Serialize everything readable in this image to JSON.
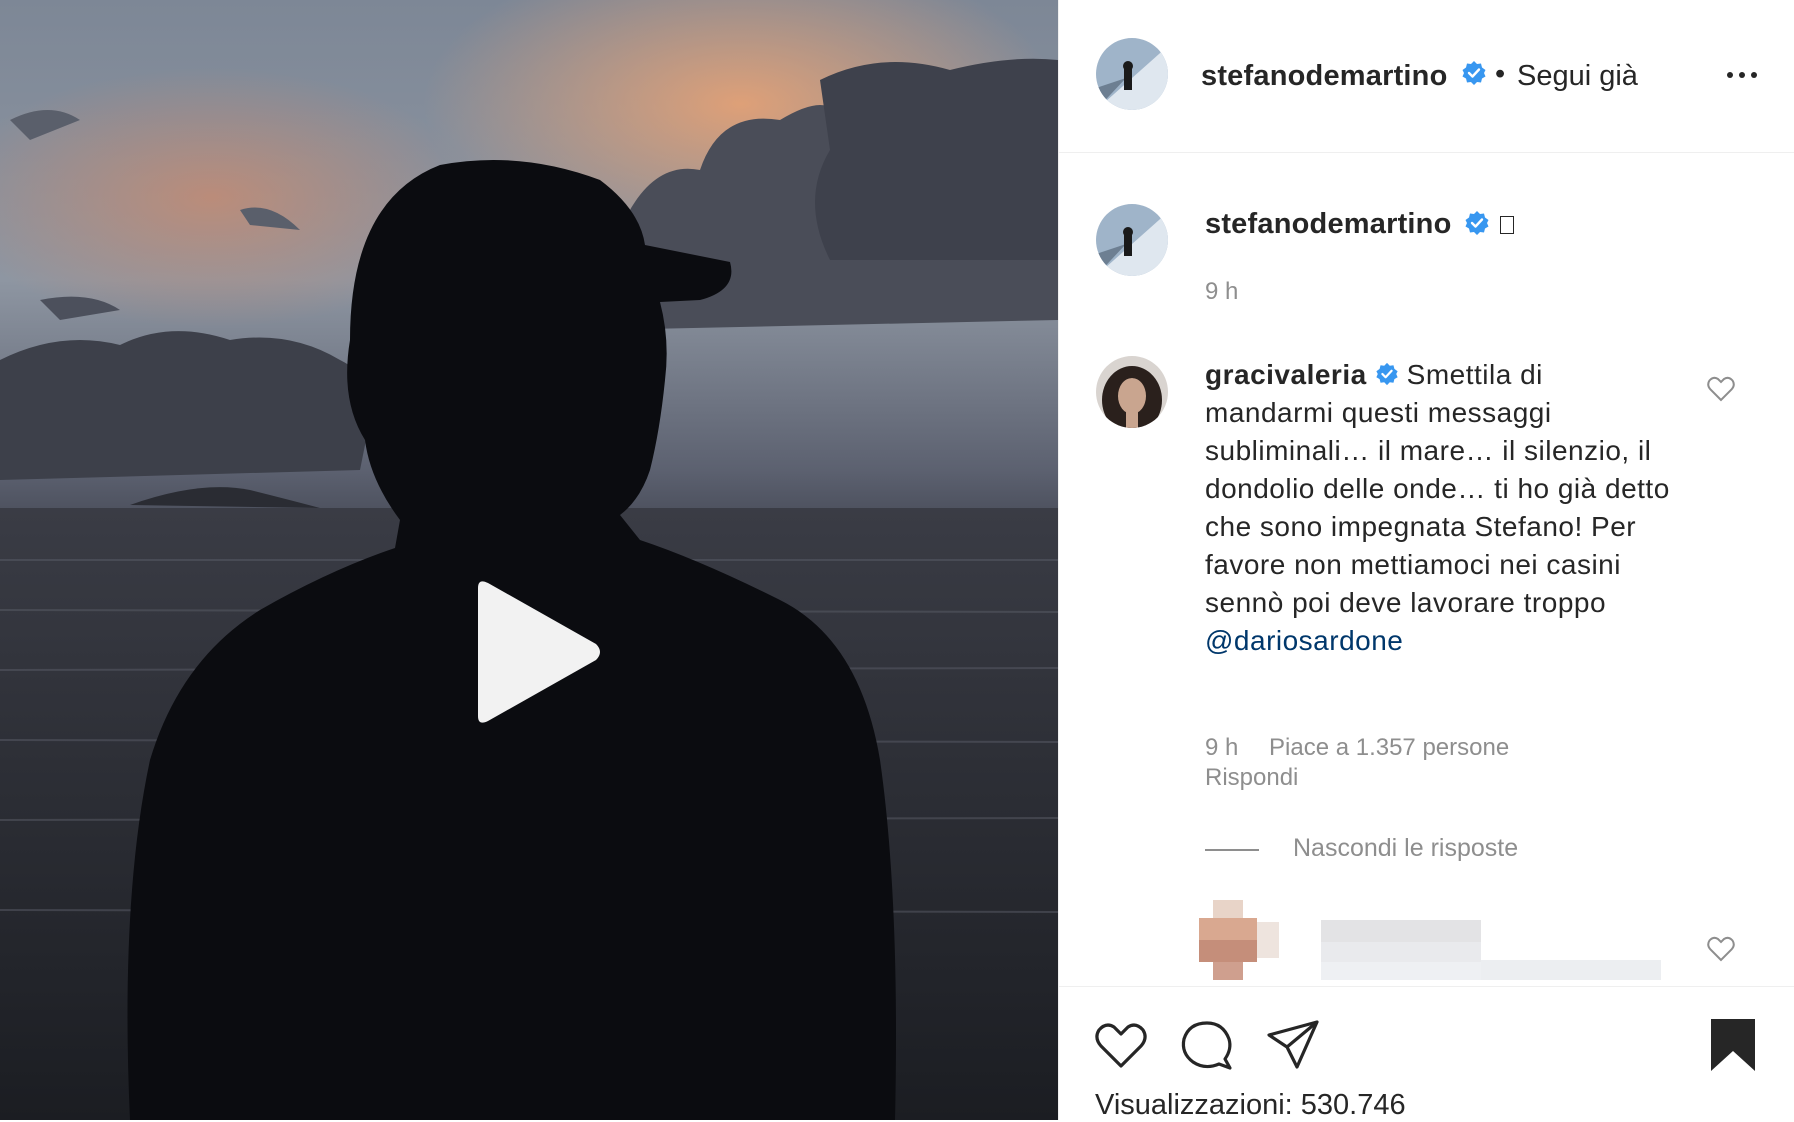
{
  "post": {
    "username": "stefanodemartino",
    "separator": "•",
    "follow_label": "Segui già"
  },
  "caption": {
    "username": "stefanodemartino",
    "time": "9 h"
  },
  "comment": {
    "username": "gracivaleria",
    "text": "Smettila di mandarmi questi messaggi subliminali… il mare… il silenzio, il dondolio delle onde… ti ho già detto che sono impegnata Stefano! Per favore non mettiamoci nei casini sennò poi deve lavorare troppo",
    "mention": "@dariosardone",
    "time": "9 h",
    "likes": "Piace a 1.357 persone",
    "reply_label": "Rispondi",
    "hide_replies": "Nascondi le risposte"
  },
  "footer": {
    "views_label": "Visualizzazioni:",
    "views_count": "530.746"
  },
  "colors": {
    "verified_blue": "#3897f0",
    "text": "#262626",
    "secondary": "#8e8e8e",
    "mention": "#00376b"
  },
  "icons": [
    "verified-badge-icon",
    "more-options-icon",
    "play-icon",
    "heart-icon",
    "comment-icon",
    "share-icon",
    "bookmark-icon"
  ]
}
